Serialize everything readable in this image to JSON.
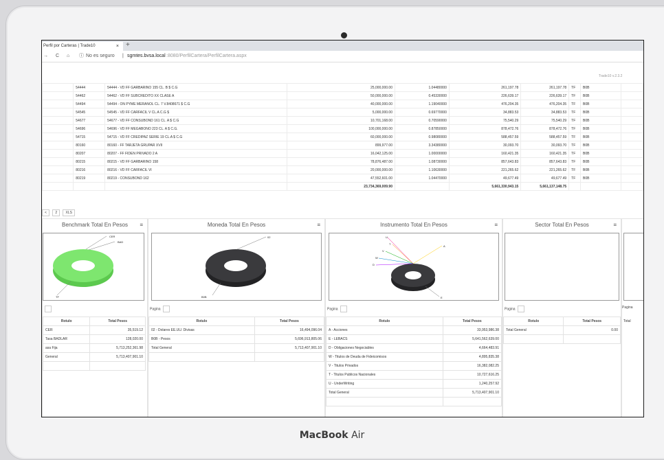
{
  "browser": {
    "tab_title": "Perfil por Carteras | Trade10",
    "tab_close": "×",
    "new_tab": "+",
    "security": "No es seguro",
    "url_host": "sgmtes.bvsa.local",
    "url_path": ":8080/PerfilCartera/PerfilCartera.aspx"
  },
  "version": "Trade10 v.2.3.2",
  "grid": {
    "rows": [
      {
        "code": "54444",
        "name": "54444 - VD FF GARBARINO 155 CL. B $ C.G",
        "nominal": "25,000,000.00",
        "price": "1.04480000",
        "v1": "261,197.78",
        "v2": "261,197.78",
        "t": "TF",
        "cur": "B0B"
      },
      {
        "code": "54462",
        "name": "54462 - VD FF SUBCREDITO XX CLASE A",
        "nominal": "50,000,000.00",
        "price": "0.45330000",
        "v1": "226,639.17",
        "v2": "226,639.17",
        "t": "TF",
        "cur": "B0B"
      },
      {
        "code": "54494",
        "name": "54494 - ON PYME MERANOL CL. 7 V.8408671 $ C.G",
        "nominal": "40,000,000.00",
        "price": "1.19040000",
        "v1": "476,204.35",
        "v2": "476,204.35",
        "t": "TF",
        "cur": "B0B"
      },
      {
        "code": "54545",
        "name": "54545 - VD FF CARFACIL V CL.A C.G $",
        "nominal": "5,000,000.00",
        "price": "0.69770000",
        "v1": "34,883.53",
        "v2": "34,883.53",
        "t": "TF",
        "cur": "B0B"
      },
      {
        "code": "54677",
        "name": "54677 - VD FF CONSUBOND 161 CL. A $ C.G",
        "nominal": "10,701,168.00",
        "price": "0.70590000",
        "v1": "75,540.29",
        "v2": "75,540.29",
        "t": "TF",
        "cur": "B0B"
      },
      {
        "code": "54696",
        "name": "54696 - VD FF MEGABONO 223 CL. A $ C.G.",
        "nominal": "100,000,000.00",
        "price": "0.87850000",
        "v1": "878,472.76",
        "v2": "878,472.76",
        "t": "TF",
        "cur": "B0B"
      },
      {
        "code": "54715",
        "name": "54715 - VD FF CREDIPAZ SERIE 19 CL.A $ C.G",
        "nominal": "60,000,000.00",
        "price": "0.98080000",
        "v1": "588,457.59",
        "v2": "588,457.59",
        "t": "TF",
        "cur": "B0B"
      },
      {
        "code": "80160",
        "name": "80160 - FF TARJETA GRUPAR XVII",
        "nominal": "899,977.00",
        "price": "3.34380000",
        "v1": "30,093.70",
        "v2": "30,093.70",
        "t": "TF",
        "cur": "B0B"
      },
      {
        "code": "80207",
        "name": "80207 - FF FIDEN PRIVADO 2 A",
        "nominal": "16,042,125.00",
        "price": "1.00000000",
        "v1": "160,421.35",
        "v2": "160,421.35",
        "t": "TF",
        "cur": "B0B"
      },
      {
        "code": "80215",
        "name": "80215 - VD FF GARBARINO 158",
        "nominal": "78,876,487.00",
        "price": "1.08730000",
        "v1": "857,643.83",
        "v2": "857,643.83",
        "t": "TF",
        "cur": "B0B"
      },
      {
        "code": "80216",
        "name": "80216 - VD FF CARFACIL VI",
        "nominal": "20,000,000.00",
        "price": "1.10630000",
        "v1": "221,265.62",
        "v2": "221,265.62",
        "t": "TF",
        "cur": "B0B"
      },
      {
        "code": "80219",
        "name": "80219 - CONSUBOND 162",
        "nominal": "47,552,601.00",
        "price": "1.04470000",
        "v1": "49,677.49",
        "v2": "49,677.49",
        "t": "TF",
        "cur": "B0B"
      }
    ],
    "totals": {
      "nominal": "23,734,369,009.90",
      "v1": "5,661,330,943.15",
      "v2": "5,661,137,148.75"
    }
  },
  "pager": {
    "prev": "<",
    "page": "2",
    "export": "XLS"
  },
  "panels": {
    "benchmark": {
      "title": "Benchmark Total En Pesos",
      "menu": "≡",
      "labels": [
        "CER",
        "BAD",
        "TF"
      ],
      "page_label": "",
      "hdr_rotulo": "Rotulo",
      "hdr_total": "Total Pesos",
      "rows": [
        {
          "r": "CER",
          "v": "35,519.12"
        },
        {
          "r": "Tasa BADLAR",
          "v": "128,020.00"
        },
        {
          "r": "asa Fija",
          "v": "5,713,252,361.98"
        },
        {
          "r": "General",
          "v": "5,713,407,901.10"
        }
      ]
    },
    "moneda": {
      "title": "Moneda Total En Pesos",
      "menu": "≡",
      "labels": [
        "02",
        "B0B"
      ],
      "page_label": "Pagina",
      "hdr_rotulo": "Rotulo",
      "hdr_total": "Total Pesos",
      "rows": [
        {
          "r": "02 - Dolares EE.UU. Divisas",
          "v": "16,494,096.04"
        },
        {
          "r": "B0B - Pesos",
          "v": "5,696,913,805.06"
        },
        {
          "r": "Total General",
          "v": "5,713,407,901.10"
        }
      ]
    },
    "instrumento": {
      "title": "Instrumento Total En Pesos",
      "menu": "≡",
      "labels": [
        "U",
        "T",
        "V",
        "W",
        "D",
        "A",
        "E"
      ],
      "page_label": "Pagina",
      "hdr_rotulo": "Rotulo",
      "hdr_total": "Total Pesos",
      "rows": [
        {
          "r": "A - Acciones",
          "v": "33,953,986.38"
        },
        {
          "r": "E - LEBACS",
          "v": "5,641,562,639.00"
        },
        {
          "r": "D - Obligaciones Negociables",
          "v": "4,664,483.91"
        },
        {
          "r": "W - Titulos de Deuda de Fideicomisos",
          "v": "4,895,835.38"
        },
        {
          "r": "V - Titulos Privados",
          "v": "16,382,082.25"
        },
        {
          "r": "T - Titulos Publicos Nacionales",
          "v": "10,727,616.25"
        },
        {
          "r": "U - UnderWriting",
          "v": "1,240,257.92"
        },
        {
          "r": "Total General",
          "v": "5,713,407,901.10"
        }
      ]
    },
    "sector": {
      "title": "Sector Total En Pesos",
      "menu": "≡",
      "page_label": "Pagina",
      "hdr_rotulo": "Rotulo",
      "hdr_total": "Total Pesos",
      "rows": [
        {
          "r": "Total General",
          "v": "0.00"
        }
      ]
    },
    "extra": {
      "page_label": "Pagina",
      "row_label": "Total"
    }
  },
  "colors": {
    "benchmark_donut": "#7ee66f",
    "dark_donut": "#3a3a3d"
  },
  "laptop_brand": {
    "a": "MacBook",
    "b": "Air"
  }
}
